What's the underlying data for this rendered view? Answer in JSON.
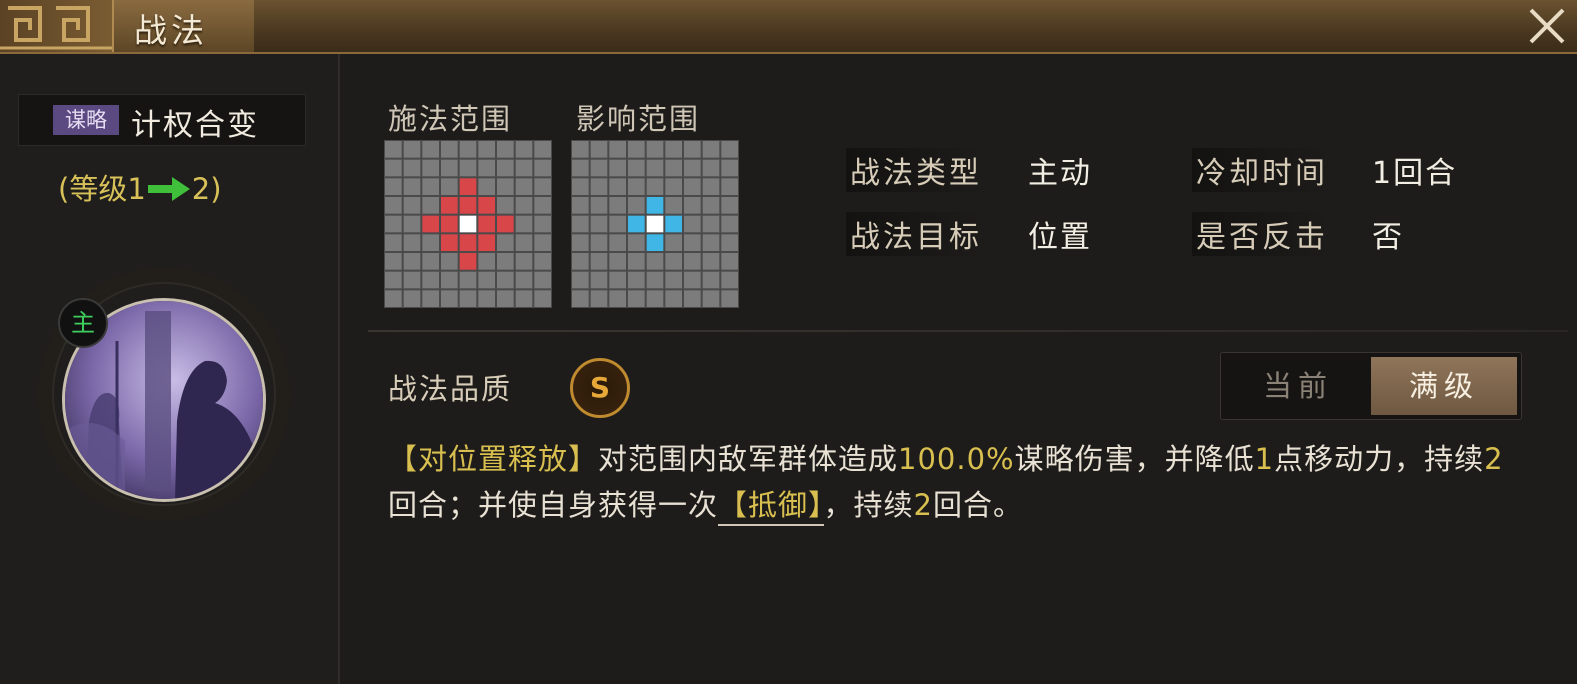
{
  "header": {
    "title": "战法"
  },
  "skill": {
    "tag": "谋略",
    "name": "计权合变",
    "level_prefix": "(等级1",
    "level_suffix": "2)",
    "main_badge": "主"
  },
  "ranges": {
    "cast_label": "施法范围",
    "effect_label": "影响范围"
  },
  "stats": {
    "type_label": "战法类型",
    "type_value": "主动",
    "cooldown_label": "冷却时间",
    "cooldown_value": "1回合",
    "target_label": "战法目标",
    "target_value": "位置",
    "counter_label": "是否反击",
    "counter_value": "否"
  },
  "quality": {
    "label": "战法品质",
    "grade": "S"
  },
  "toggle": {
    "current": "当前",
    "max": "满级",
    "selected": "满级"
  },
  "description": {
    "tag": "【对位置释放】",
    "t1": "对范围内敌军群体造成",
    "damage": "100.0%",
    "t2": "谋略伤害，并降低",
    "reduce": "1",
    "t3": "点移动力，持续",
    "dur1": "2",
    "t4": "回合；并使自身获得一次",
    "buff": "【抵御】",
    "t5": "，持续",
    "dur2": "2",
    "t6": "回合。"
  },
  "colors": {
    "cast_cell": "#d9464a",
    "effect_cell": "#3fb6e6",
    "center_cell": "#ffffff",
    "highlight": "#d8bf4f",
    "level_arrow": "#3fbf3a"
  }
}
